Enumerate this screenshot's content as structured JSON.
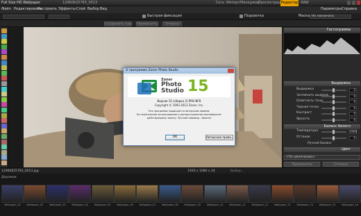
{
  "window": {
    "title": "Full Size HD Wallpaper",
    "file_title": "12960625783_0013",
    "tabs": [
      "Сеть",
      "Импорт",
      "Менеджер",
      "Просмотрщик",
      "Редактор",
      "RAW"
    ],
    "active_tab": "Редактор"
  },
  "menu": [
    "Файл",
    "Редактировать",
    "Настроить",
    "Эффекты",
    "Слой",
    "Выбор",
    "Вид"
  ],
  "menu_right": [
    "Параметры",
    "Справка"
  ],
  "optbar": {
    "label1": "Быстрая фиксация",
    "label2": "Подсветка",
    "label3": "Маска:",
    "mask_value": "Не назначать"
  },
  "subbar": [
    "Сохранить как...",
    "Применить",
    "Отмена"
  ],
  "right": {
    "histogram": "Гистограмма",
    "section_main": "Выдержка",
    "rows": [
      {
        "label": "Выдержка",
        "value": "0"
      },
      {
        "label": "Затемнить выдерж.",
        "value": "0"
      },
      {
        "label": "Осветлить тени",
        "value": "0"
      },
      {
        "label": "Черная точка",
        "value": "0"
      },
      {
        "label": "Контраст",
        "value": "0"
      },
      {
        "label": "Яркость",
        "value": "0"
      }
    ],
    "section_wb": "Баланс белого",
    "wb_rows": [
      {
        "label": "Температура",
        "value": "5000"
      },
      {
        "label": "Оттенок",
        "value": "0"
      }
    ],
    "manual": "Ручной баланс",
    "section_color": "Цвет",
    "preset": "<По умолчанию>",
    "apply": "Применить",
    "cancel": "Отмена"
  },
  "status": {
    "filename": "12960625783_0013.jpg",
    "info": "1920 x 1080 x 24",
    "mid": "Выбор..."
  },
  "filmstrip": {
    "label": "Дорожки",
    "thumbs": [
      "Wallpaper_01",
      "Wallpaper_02",
      "Wallpaper_03",
      "Wallpaper_04",
      "Wallpaper_05",
      "Wallpaper_06",
      "Wallpaper_07",
      "Wallpaper_08",
      "Wallpaper_09",
      "Wallpaper_10",
      "Wallpaper_11",
      "Wallpaper_12",
      "Wallpaper_13",
      "Wallpaper_14",
      "Wallpaper_15",
      "Wallpaper_16"
    ]
  },
  "dialog": {
    "title": "О программе Zoner Photo Studio",
    "logo_line1": "Zoner",
    "logo_line2": "Photo",
    "logo_line3": "Studio",
    "logo_num": "15",
    "version": "Версия 15 (сборка 3) PRO NFR",
    "copyright": "Copyright © 1993-2012 Zoner, Inc.",
    "text1": "Эта программа защищается авторским правом.",
    "text2": "Ее нелегальное использование и распространение противоречит",
    "text3": "действующему закону. Русский перевод - Boomer",
    "ok": "OK",
    "rights": "Авторские права..."
  },
  "colors": {
    "accent": "#e8a000",
    "dialog_bg": "#f0f0f0",
    "logo_green": "#1a8c3a",
    "logo_blue": "#1e6fb8"
  }
}
